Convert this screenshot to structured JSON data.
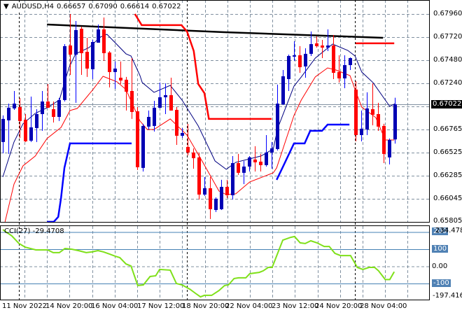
{
  "header": {
    "symbol": "AUDUSD,H4",
    "open": "0.66657",
    "high": "0.67090",
    "low": "0.66614",
    "close": "0.67022"
  },
  "price_axis": [
    "0.67960",
    "0.67720",
    "0.67480",
    "0.67240",
    "0.66765",
    "0.66525",
    "0.66285",
    "0.66045",
    "0.65805"
  ],
  "current_price_label": "0.67022",
  "cci": {
    "title": "CCI(27)",
    "value": "-29.4708",
    "max_label": "234.4783",
    "min_label": "-197.4164",
    "levels": [
      "200",
      "100",
      "0.00",
      "-100"
    ]
  },
  "time_axis": [
    "11 Nov 2022",
    "14 Nov 20:00",
    "16 Nov 04:00",
    "17 Nov 12:00",
    "18 Nov 20:00",
    "22 Nov 04:00",
    "23 Nov 12:00",
    "24 Nov 20:00",
    "28 Nov 04:00"
  ],
  "colors": {
    "bull": "#0000b4",
    "bull_wick": "#0000ff",
    "bear": "#ff0000",
    "ma_fast": "#000080",
    "ma_slow": "#ff0000",
    "cci": "#7fe01a",
    "level": "#4682b4",
    "trend": "#000000"
  },
  "chart_data": {
    "type": "candlestick",
    "title": "AUDUSD,H4",
    "ylim": [
      0.65805,
      0.6796
    ],
    "candles_ohlc": [
      [
        0.6663,
        0.66906,
        0.66513,
        0.6687
      ],
      [
        0.66855,
        0.67029,
        0.66506,
        0.66986
      ],
      [
        0.66979,
        0.6716,
        0.66964,
        0.67029
      ],
      [
        0.66993,
        0.67088,
        0.66673,
        0.66848
      ],
      [
        0.66862,
        0.6692,
        0.6663,
        0.66637
      ],
      [
        0.66644,
        0.67102,
        0.6663,
        0.66782
      ],
      [
        0.66775,
        0.66971,
        0.6663,
        0.6692
      ],
      [
        0.6692,
        0.6716,
        0.66746,
        0.67051
      ],
      [
        0.67051,
        0.67233,
        0.66986,
        0.66986
      ],
      [
        0.66971,
        0.67051,
        0.66833,
        0.66891
      ],
      [
        0.66891,
        0.67088,
        0.66848,
        0.67066
      ],
      [
        0.67066,
        0.67647,
        0.67051,
        0.67626
      ],
      [
        0.67633,
        0.6796,
        0.67327,
        0.67538
      ],
      [
        0.67538,
        0.67887,
        0.67037,
        0.67793
      ],
      [
        0.67807,
        0.67829,
        0.67327,
        0.67553
      ],
      [
        0.67567,
        0.67713,
        0.67306,
        0.67393
      ],
      [
        0.67386,
        0.67691,
        0.67284,
        0.67669
      ],
      [
        0.67662,
        0.67851,
        0.67662,
        0.678
      ],
      [
        0.678,
        0.67924,
        0.67473,
        0.67553
      ],
      [
        0.6756,
        0.67575,
        0.67197,
        0.67357
      ],
      [
        0.67357,
        0.67466,
        0.67182,
        0.67393
      ],
      [
        0.67298,
        0.67466,
        0.67233,
        0.67269
      ],
      [
        0.67277,
        0.67306,
        0.66957,
        0.67153
      ],
      [
        0.6716,
        0.67502,
        0.6687,
        0.66942
      ],
      [
        0.66949,
        0.66993,
        0.66339,
        0.66368
      ],
      [
        0.66361,
        0.66819,
        0.66324,
        0.66797
      ],
      [
        0.6679,
        0.66957,
        0.6676,
        0.66891
      ],
      [
        0.66797,
        0.67058,
        0.66739,
        0.66986
      ],
      [
        0.66986,
        0.67248,
        0.66979,
        0.67095
      ],
      [
        0.67095,
        0.6724,
        0.6692,
        0.67117
      ],
      [
        0.67117,
        0.67298,
        0.66957,
        0.66957
      ],
      [
        0.66964,
        0.66993,
        0.666,
        0.66695
      ],
      [
        0.66695,
        0.66775,
        0.66673,
        0.66724
      ],
      [
        0.66579,
        0.66819,
        0.66491,
        0.66521
      ],
      [
        0.66521,
        0.66564,
        0.66353,
        0.66462
      ],
      [
        0.6647,
        0.66521,
        0.66033,
        0.66084
      ],
      [
        0.66084,
        0.66266,
        0.6607,
        0.6615
      ],
      [
        0.6615,
        0.66266,
        0.6583,
        0.65932
      ],
      [
        0.65924,
        0.66055,
        0.65903,
        0.66041
      ],
      [
        0.65932,
        0.66237,
        0.65924,
        0.66164
      ],
      [
        0.66164,
        0.66237,
        0.66048,
        0.66077
      ],
      [
        0.66077,
        0.66484,
        0.66033,
        0.66411
      ],
      [
        0.66411,
        0.66506,
        0.66288,
        0.6631
      ],
      [
        0.6631,
        0.66433,
        0.66193,
        0.66375
      ],
      [
        0.66375,
        0.66484,
        0.66324,
        0.6647
      ],
      [
        0.66448,
        0.66586,
        0.66324,
        0.66419
      ],
      [
        0.66426,
        0.66506,
        0.66324,
        0.6639
      ],
      [
        0.6639,
        0.66702,
        0.66375,
        0.66521
      ],
      [
        0.66521,
        0.6663,
        0.66353,
        0.66564
      ],
      [
        0.66557,
        0.67226,
        0.66542,
        0.67029
      ],
      [
        0.67022,
        0.67378,
        0.67015,
        0.67313
      ],
      [
        0.67284,
        0.67538,
        0.6716,
        0.67524
      ],
      [
        0.67517,
        0.67676,
        0.67473,
        0.67531
      ],
      [
        0.67531,
        0.67626,
        0.67349,
        0.67407
      ],
      [
        0.67415,
        0.67604,
        0.67298,
        0.67546
      ],
      [
        0.67546,
        0.67778,
        0.67524,
        0.67647
      ],
      [
        0.67655,
        0.67727,
        0.67611,
        0.67626
      ],
      [
        0.67633,
        0.67691,
        0.67502,
        0.67611
      ],
      [
        0.67611,
        0.678,
        0.67575,
        0.67633
      ],
      [
        0.67633,
        0.67742,
        0.67284,
        0.67349
      ],
      [
        0.67357,
        0.67531,
        0.67248,
        0.67291
      ],
      [
        0.67291,
        0.67531,
        0.67189,
        0.67429
      ],
      [
        0.67429,
        0.67509,
        0.67378,
        0.67502
      ],
      [
        0.67175,
        0.67262,
        0.66637,
        0.66702
      ],
      [
        0.66702,
        0.66957,
        0.66637,
        0.66768
      ],
      [
        0.6676,
        0.67146,
        0.66702,
        0.66979
      ],
      [
        0.66971,
        0.6724,
        0.66804,
        0.66913
      ],
      [
        0.6692,
        0.67037,
        0.66746,
        0.6679
      ],
      [
        0.66797,
        0.66819,
        0.66411,
        0.66506
      ],
      [
        0.6647,
        0.66666,
        0.66397,
        0.66651
      ],
      [
        0.66657,
        0.6709,
        0.66614,
        0.67022
      ]
    ],
    "ma_fast": [
      [
        0,
        0.66266
      ],
      [
        2,
        0.6663
      ],
      [
        3.6,
        0.66819
      ],
      [
        5.8,
        0.66928
      ],
      [
        7.9,
        0.66986
      ],
      [
        10.1,
        0.67066
      ],
      [
        11.8,
        0.674
      ],
      [
        13,
        0.67546
      ],
      [
        15.4,
        0.67611
      ],
      [
        17.4,
        0.6772
      ],
      [
        18.6,
        0.67749
      ],
      [
        22,
        0.67546
      ],
      [
        22.9,
        0.67524
      ],
      [
        24.5,
        0.6732
      ],
      [
        24.9,
        0.67248
      ],
      [
        27,
        0.67146
      ],
      [
        29.9,
        0.67218
      ],
      [
        32,
        0.67066
      ],
      [
        34.9,
        0.66797
      ],
      [
        37.9,
        0.66433
      ],
      [
        39.9,
        0.66346
      ],
      [
        41.6,
        0.66419
      ],
      [
        44.1,
        0.66455
      ],
      [
        46.1,
        0.66484
      ],
      [
        48.3,
        0.66557
      ],
      [
        49.1,
        0.66775
      ],
      [
        52,
        0.67211
      ],
      [
        53.3,
        0.67306
      ],
      [
        55.8,
        0.67502
      ],
      [
        58.9,
        0.67647
      ],
      [
        61.6,
        0.67582
      ],
      [
        62.9,
        0.67524
      ],
      [
        64.1,
        0.67357
      ],
      [
        66.1,
        0.67248
      ],
      [
        69.1,
        0.67
      ],
      [
        70.1,
        0.67029
      ]
    ],
    "ma_slow": [
      [
        0.4,
        0.65801
      ],
      [
        2,
        0.66193
      ],
      [
        3.6,
        0.66382
      ],
      [
        5.8,
        0.66484
      ],
      [
        7.9,
        0.66666
      ],
      [
        10.4,
        0.66782
      ],
      [
        12,
        0.66957
      ],
      [
        13.3,
        0.66979
      ],
      [
        16.1,
        0.67175
      ],
      [
        17.9,
        0.67313
      ],
      [
        20.4,
        0.67255
      ],
      [
        22,
        0.67175
      ],
      [
        24.5,
        0.66848
      ],
      [
        25.8,
        0.6676
      ],
      [
        27,
        0.6676
      ],
      [
        29.9,
        0.6687
      ],
      [
        32.9,
        0.66702
      ],
      [
        35.8,
        0.66411
      ],
      [
        38.6,
        0.66121
      ],
      [
        39.9,
        0.66084
      ],
      [
        41.6,
        0.66092
      ],
      [
        44.1,
        0.66215
      ],
      [
        48.3,
        0.6631
      ],
      [
        48.9,
        0.66361
      ],
      [
        52,
        0.66906
      ],
      [
        53.3,
        0.67066
      ],
      [
        55.8,
        0.67306
      ],
      [
        58,
        0.674
      ],
      [
        59.5,
        0.67378
      ],
      [
        62,
        0.6732
      ],
      [
        63,
        0.6716
      ],
      [
        64.1,
        0.66993
      ],
      [
        66.6,
        0.66884
      ],
      [
        68.3,
        0.66651
      ],
      [
        69.9,
        0.66651
      ]
    ],
    "resistance_steps": [
      [
        [
          23.6,
          0.6796
        ],
        [
          24.8,
          0.67844
        ],
        [
          31.9,
          0.67844
        ],
        [
          32.9,
          0.67778
        ],
        [
          34.1,
          0.67575
        ],
        [
          34.9,
          0.67233
        ],
        [
          36,
          0.67138
        ],
        [
          36.8,
          0.6687
        ],
        [
          48,
          0.6687
        ]
      ],
      [
        [
          63,
          0.67655
        ],
        [
          69.9,
          0.67655
        ]
      ]
    ],
    "support_steps": [
      [
        [
          7.9,
          0.65801
        ],
        [
          9.1,
          0.65801
        ],
        [
          9.9,
          0.65852
        ],
        [
          10.4,
          0.66048
        ],
        [
          11,
          0.66361
        ],
        [
          12,
          0.66615
        ],
        [
          23,
          0.66615
        ]
      ],
      [
        [
          48.9,
          0.66237
        ],
        [
          50.1,
          0.66382
        ],
        [
          52,
          0.66615
        ],
        [
          53.9,
          0.66615
        ],
        [
          54.9,
          0.66746
        ],
        [
          57,
          0.66746
        ],
        [
          58,
          0.66811
        ],
        [
          61.9,
          0.66811
        ]
      ]
    ],
    "trendline": [
      [
        7.9,
        0.67851
      ],
      [
        39.6,
        0.67771
      ],
      [
        67.9,
        0.67713
      ]
    ],
    "cci_series": [
      [
        0,
        216
      ],
      [
        1.6,
        180
      ],
      [
        2.9,
        135
      ],
      [
        4,
        114
      ],
      [
        5.9,
        98
      ],
      [
        8,
        98
      ],
      [
        9,
        82
      ],
      [
        10.1,
        82
      ],
      [
        11.1,
        106
      ],
      [
        12.3,
        102
      ],
      [
        13.5,
        94
      ],
      [
        14.9,
        82
      ],
      [
        15.9,
        86
      ],
      [
        17,
        94
      ],
      [
        18,
        86
      ],
      [
        19.1,
        73
      ],
      [
        20.1,
        61
      ],
      [
        20.9,
        53
      ],
      [
        22,
        16
      ],
      [
        22.9,
        4
      ],
      [
        24.1,
        -110
      ],
      [
        25.1,
        -106
      ],
      [
        26.3,
        -57
      ],
      [
        27.3,
        -53
      ],
      [
        28,
        -16
      ],
      [
        29.9,
        -20
      ],
      [
        31,
        -98
      ],
      [
        32,
        -106
      ],
      [
        33.4,
        -131
      ],
      [
        34.4,
        -155
      ],
      [
        35.3,
        -176
      ],
      [
        36,
        -167
      ],
      [
        37.3,
        -167
      ],
      [
        38.6,
        -139
      ],
      [
        39.6,
        -110
      ],
      [
        40.3,
        -106
      ],
      [
        41.3,
        -69
      ],
      [
        42.1,
        -65
      ],
      [
        43.4,
        -65
      ],
      [
        44.1,
        -41
      ],
      [
        45.8,
        -33
      ],
      [
        46.5,
        -24
      ],
      [
        47.4,
        -4
      ],
      [
        48.1,
        -4
      ],
      [
        50,
        155
      ],
      [
        51.4,
        171
      ],
      [
        52.1,
        176
      ],
      [
        53.1,
        139
      ],
      [
        54,
        135
      ],
      [
        55,
        151
      ],
      [
        56.1,
        139
      ],
      [
        57.4,
        118
      ],
      [
        58.3,
        118
      ],
      [
        59.3,
        78
      ],
      [
        60.3,
        65
      ],
      [
        62.1,
        65
      ],
      [
        63.3,
        -4
      ],
      [
        64.3,
        -16
      ],
      [
        65.4,
        -4
      ],
      [
        66.4,
        -4
      ],
      [
        67.1,
        -24
      ],
      [
        68.3,
        -75
      ],
      [
        69.1,
        -75
      ],
      [
        69.9,
        -29.47
      ]
    ],
    "cci_ylim": [
      -197.4164,
      234.4783
    ]
  }
}
